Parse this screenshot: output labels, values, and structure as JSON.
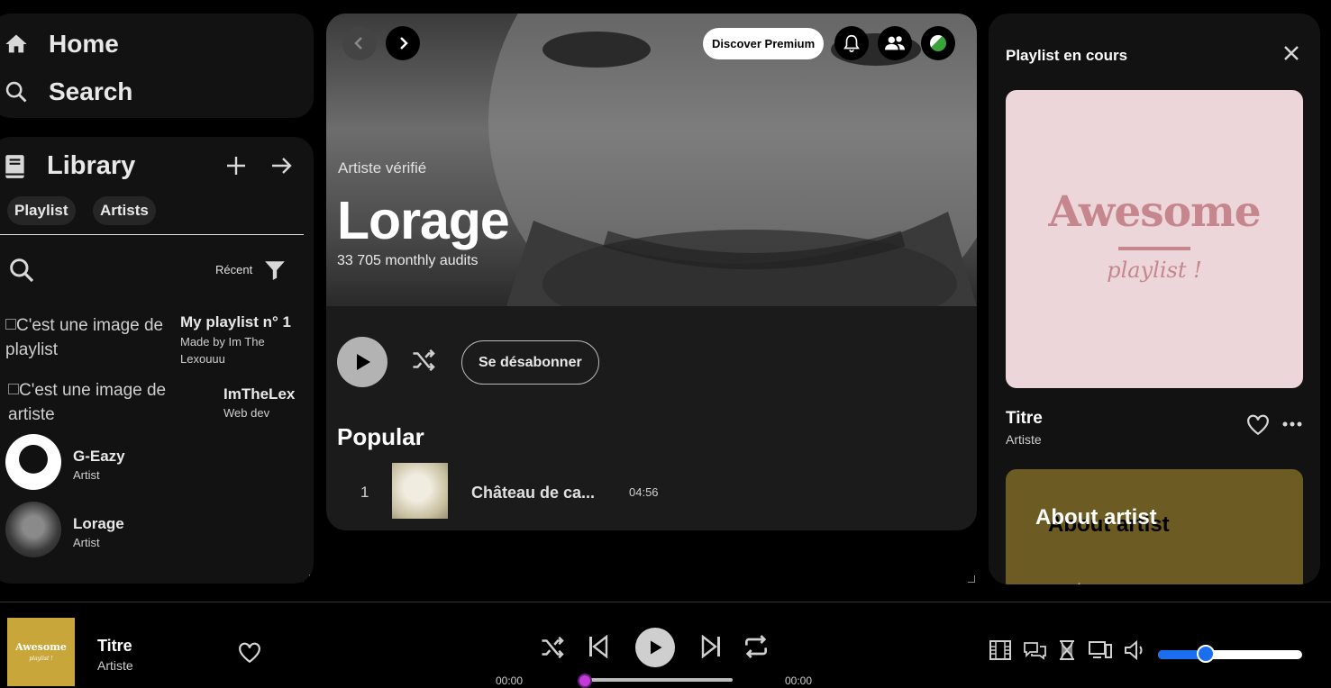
{
  "nav": {
    "home": "Home",
    "search": "Search"
  },
  "library": {
    "title": "Library",
    "chips": [
      "Playlist",
      "Artists"
    ],
    "sort_label": "Récent",
    "items": [
      {
        "alt": "C'est une image de playlist",
        "title": "My playlist n° 1",
        "sub": "Made by Im The Lexouuu"
      },
      {
        "alt": "C'est une image de artiste",
        "title": "ImTheLex",
        "sub": "Web dev"
      },
      {
        "title": "G-Eazy",
        "sub": "Artist"
      },
      {
        "title": "Lorage",
        "sub": "Artist"
      }
    ]
  },
  "main": {
    "premium_label": "Discover Premium",
    "verified_label": "Artiste vérifié",
    "artist_name": "Lorage",
    "monthly_listeners": "33 705 monthly audits",
    "unfollow_label": "Se désabonner",
    "popular_title": "Popular",
    "tracks": [
      {
        "number": "1",
        "title": "Château de ca...",
        "duration": "04:56"
      }
    ]
  },
  "right_panel": {
    "title": "Playlist en cours",
    "cover_word": "Awesome",
    "cover_sub": "playlist !",
    "track_title": "Titre",
    "track_artist": "Artiste",
    "about_title": "About artist"
  },
  "player": {
    "cover_word": "Awesome",
    "cover_sub": "playlist !",
    "title": "Titre",
    "artist": "Artiste",
    "time_current": "00:00",
    "time_total": "00:00",
    "progress": 0,
    "volume": 0.33
  },
  "colors": {
    "accent": "#1a6ef0",
    "progress_thumb": "#c53bd8",
    "cover_pink": "#ecd6d9",
    "cover_gold": "#c8a63a",
    "about_card": "#6c5c24"
  }
}
